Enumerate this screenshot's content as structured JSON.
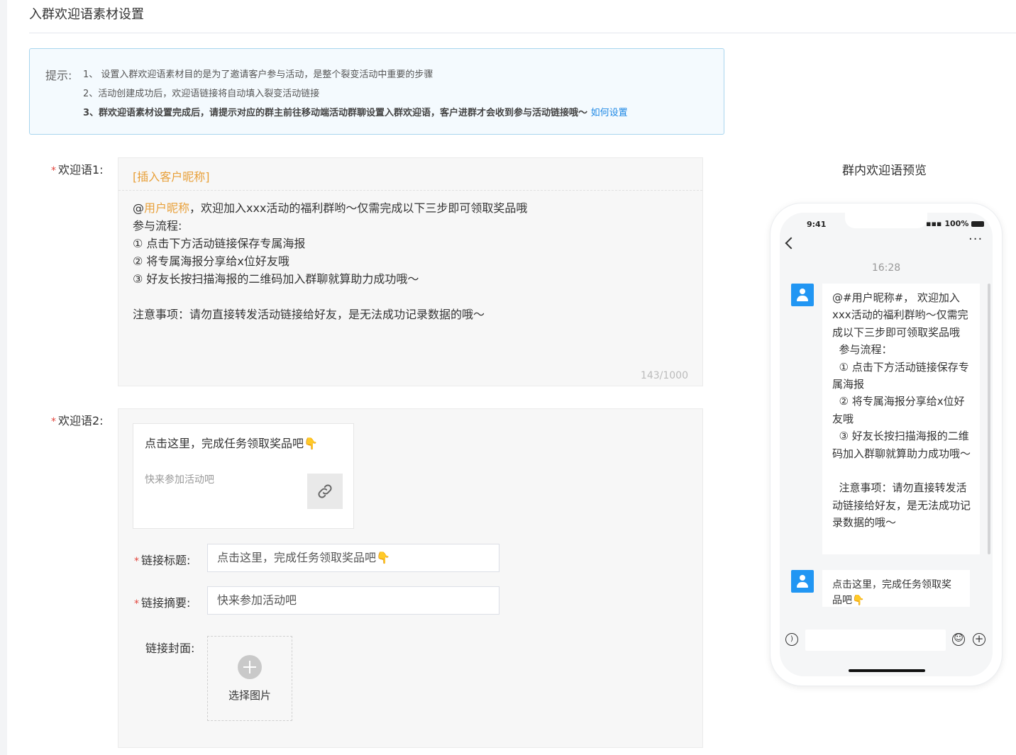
{
  "page": {
    "title": "入群欢迎语素材设置"
  },
  "tips": {
    "label": "提示:",
    "line1": "1、 设置入群欢迎语素材目的是为了邀请客户参与活动，是整个裂变活动中重要的步骤",
    "line2": "2、活动创建成功后，欢迎语链接将自动填入裂变活动链接",
    "line3": "3、群欢迎语素材设置完成后，请提示对应的群主前往移动端活动群聊设置入群欢迎语，客户进群才会收到参与活动链接哦～",
    "link": "如何设置"
  },
  "welcome1": {
    "required_mark": "*",
    "label": "欢迎语1:",
    "insert_button": "[插入客户昵称]",
    "at": "@",
    "nickname": "用户昵称",
    "body": "，欢迎加入xxx活动的福利群哟～仅需完成以下三步即可领取奖品哦\n参与流程:\n① 点击下方活动链接保存专属海报\n② 将专属海报分享给x位好友哦\n③ 好友长按扫描海报的二维码加入群聊就算助力成功哦～\n\n注意事项：请勿直接转发活动链接给好友，是无法成功记录数据的哦～",
    "counter": "143/1000"
  },
  "welcome2": {
    "required_mark": "*",
    "label": "欢迎语2:",
    "card_title": "点击这里，完成任务领取奖品吧👇",
    "card_desc": "快来参加活动吧",
    "link_title_label": "链接标题:",
    "link_title_value": "点击这里，完成任务领取奖品吧👇",
    "link_summary_label": "链接摘要:",
    "link_summary_value": "快来参加活动吧",
    "link_cover_label": "链接封面:",
    "upload_text": "选择图片"
  },
  "preview": {
    "title": "群内欢迎语预览",
    "status_time": "9:41",
    "battery": "100%",
    "chat_time": "16:28",
    "message1": "@#用户昵称#， 欢迎加入xxx活动的福利群哟～仅需完成以下三步即可领取奖品哦\n  参与流程：\n  ① 点击下方活动链接保存专属海报\n  ② 将专属海报分享给x位好友哦\n  ③ 好友长按扫描海报的二维码加入群聊就算助力成功哦～\n\n  注意事项：请勿直接转发活动链接给好友，是无法成功记录数据的哦～",
    "message2": "点击这里，完成任务领取奖品吧👇"
  },
  "colors": {
    "accent": "#1e88e5",
    "nickname": "#e8a03a",
    "required": "#e2453c",
    "tip_border": "#a9d6ee",
    "avatar": "#2196f3"
  },
  "icons": [
    "link-icon",
    "plus-icon",
    "back-icon",
    "more-icon",
    "voice-icon",
    "emoji-icon",
    "add-icon",
    "avatar-icon"
  ]
}
